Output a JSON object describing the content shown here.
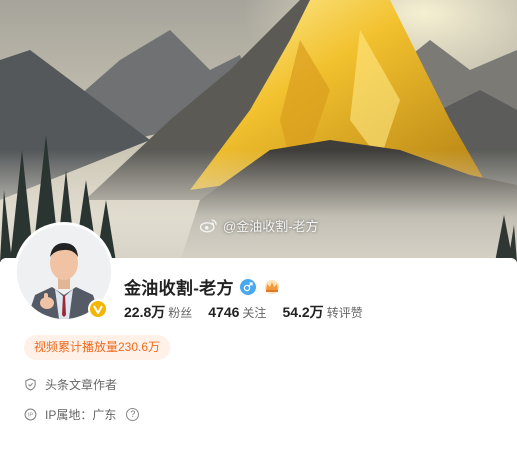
{
  "cover": {
    "watermark": "@金油收割-老方"
  },
  "profile": {
    "name": "金油收割-老方",
    "stats": [
      {
        "value": "22.8万",
        "label": "粉丝"
      },
      {
        "value": "4746",
        "label": "关注"
      },
      {
        "value": "54.2万",
        "label": "转评赞"
      }
    ],
    "play_badge": "视频累计播放量230.6万",
    "tag": "头条文章作者",
    "ip": "IP属地：广东"
  },
  "icons": {
    "verified": "verified-v-icon",
    "gender": "male-icon",
    "vip": "crown-icon",
    "tag": "shield-icon",
    "ip": "ip-location-icon",
    "help": "question-icon"
  },
  "colors": {
    "accent_orange": "#ec6a1f",
    "badge_bg": "#fff1e8",
    "verified_gold": "#f5b400",
    "male_blue": "#4aa8ef"
  }
}
